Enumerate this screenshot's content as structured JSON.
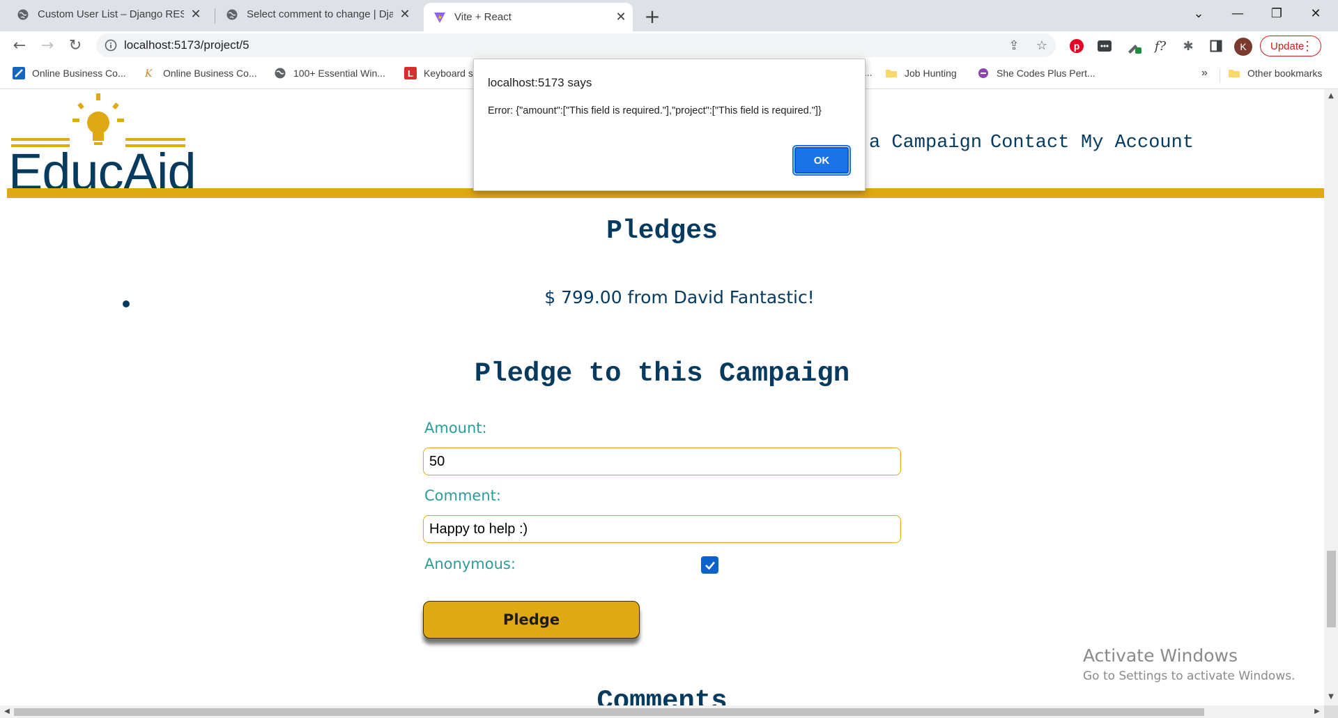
{
  "browser": {
    "tabs": [
      {
        "title": "Custom User List – Django REST f",
        "active": false
      },
      {
        "title": "Select comment to change | Djan",
        "active": false
      },
      {
        "title": "Vite + React",
        "active": true
      }
    ],
    "url": "localhost:5173/project/5",
    "profile_initial": "K",
    "update_label": "Update",
    "bookmarks": [
      "Online Business Co...",
      "Online Business Co...",
      "100+ Essential Win...",
      "Keyboard s",
      "...",
      "Job Hunting",
      "She Codes Plus Pert..."
    ],
    "overflow_label": "»",
    "other_bookmarks": "Other bookmarks"
  },
  "site": {
    "logo_text": "EducAid",
    "nav": [
      "a Campaign",
      "Contact",
      "My Account"
    ],
    "accent_color": "#e0a812",
    "brand_color": "#063a5e"
  },
  "pledges": {
    "heading": "Pledges",
    "items": [
      "$ 799.00 from David Fantastic!"
    ]
  },
  "form": {
    "heading": "Pledge to this Campaign",
    "amount_label": "Amount:",
    "amount_value": "50",
    "comment_label": "Comment:",
    "comment_value": "Happy to help :)",
    "anonymous_label": "Anonymous:",
    "anonymous_checked": true,
    "submit_label": "Pledge"
  },
  "comments": {
    "heading": "Comments"
  },
  "watermark": {
    "title": "Activate Windows",
    "subtitle": "Go to Settings to activate Windows."
  },
  "dialog": {
    "title": "localhost:5173 says",
    "message": "Error: {\"amount\":[\"This field is required.\"],\"project\":[\"This field is required.\"]}",
    "ok_label": "OK"
  }
}
